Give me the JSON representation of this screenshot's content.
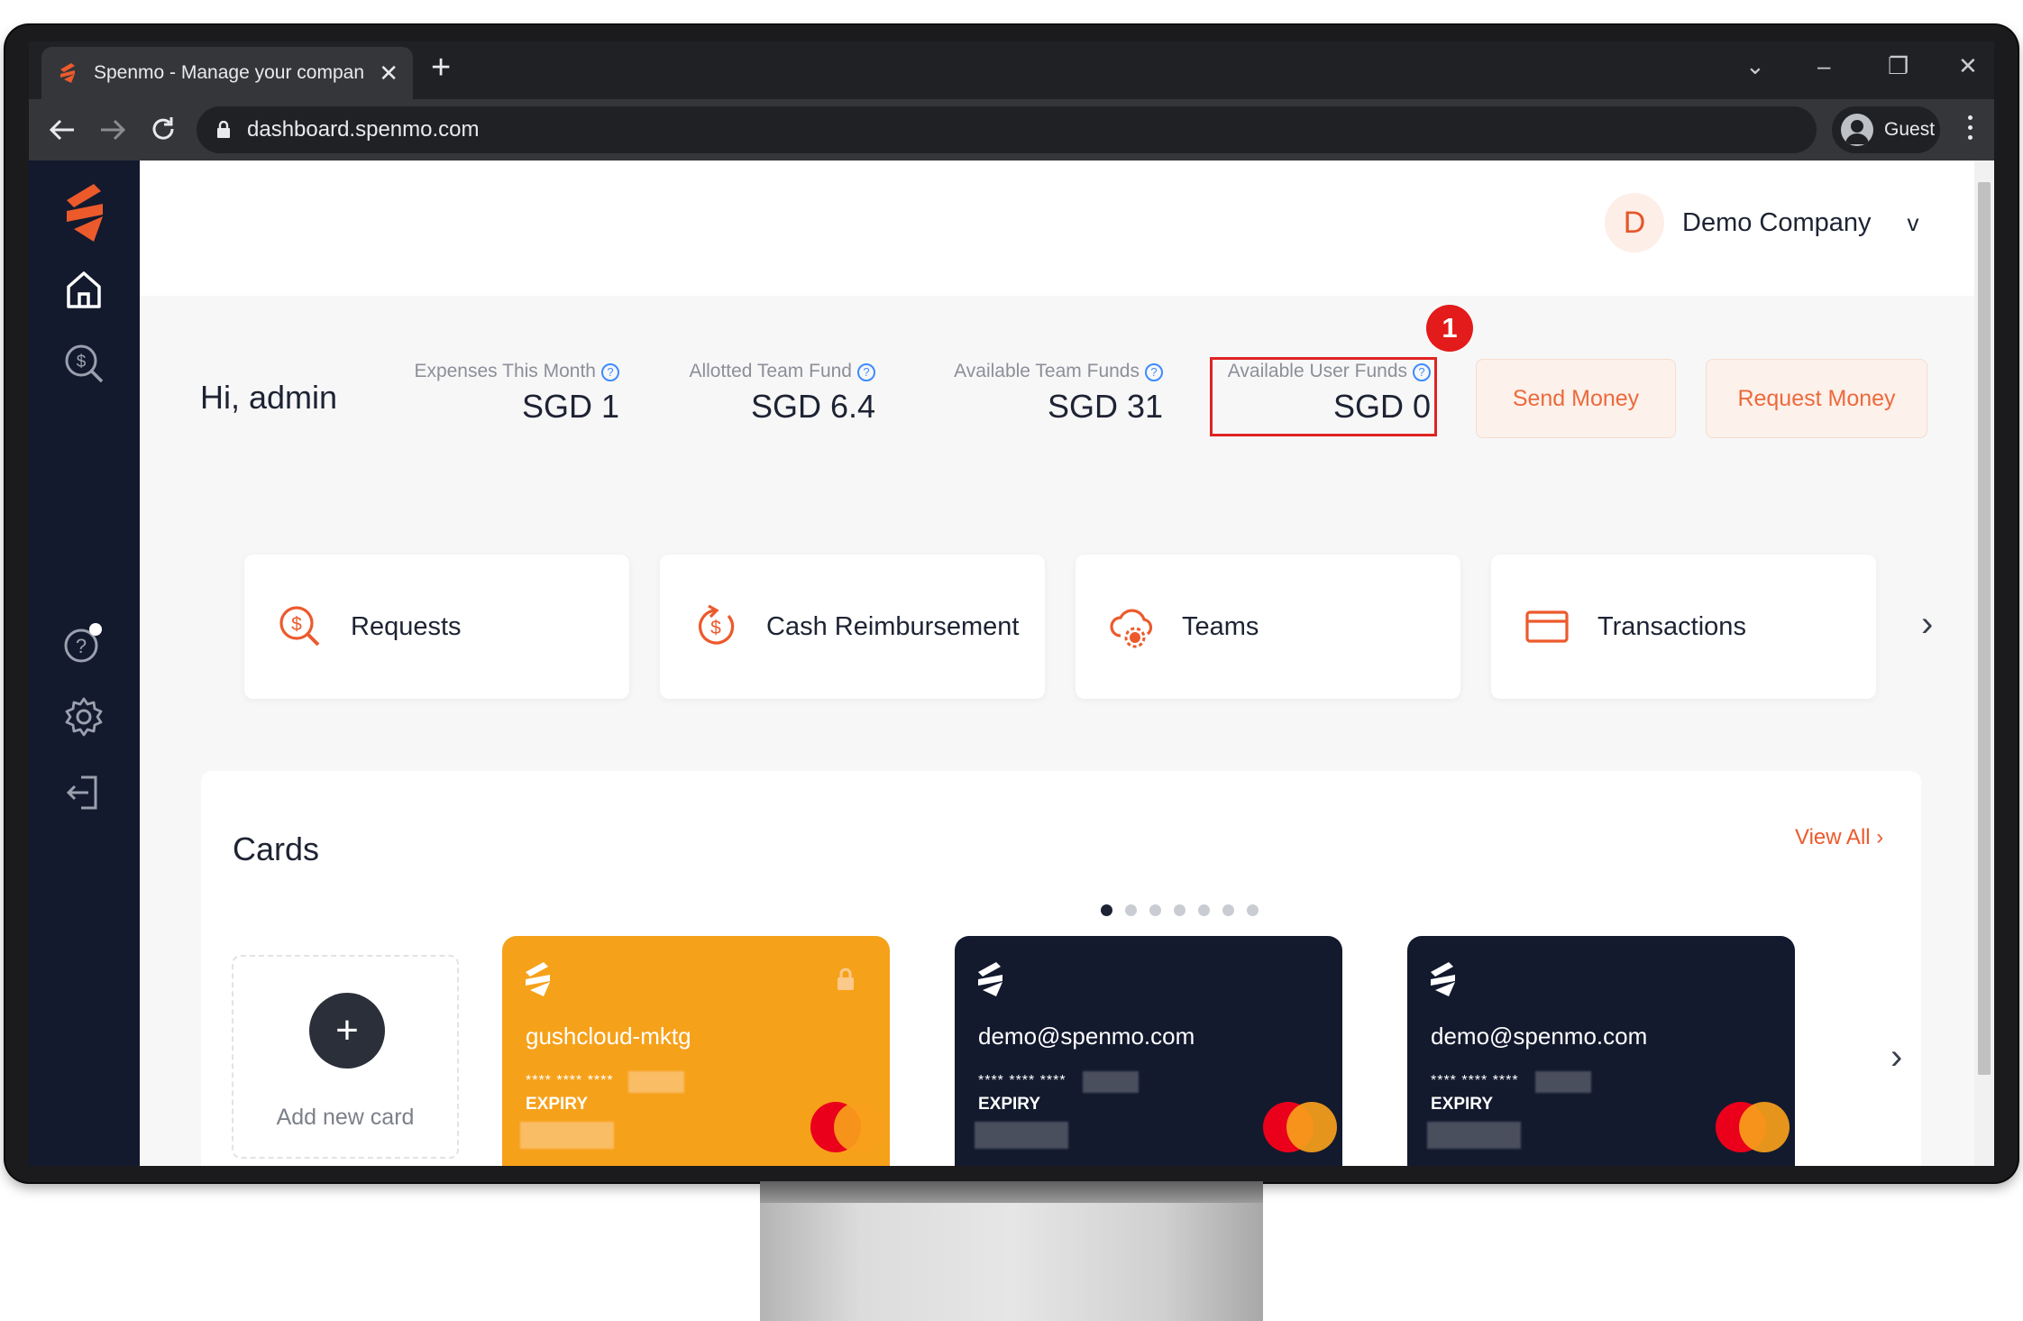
{
  "browser": {
    "tab_title": "Spenmo - Manage your company",
    "tab_close": "✕",
    "new_tab": "+",
    "url": "dashboard.spenmo.com",
    "profile_name": "Guest",
    "window_controls": [
      "⌄",
      "–",
      "❐",
      "✕"
    ]
  },
  "header": {
    "company_initial": "D",
    "company_name": "Demo Company",
    "company_caret": "v"
  },
  "summary": {
    "greeting": "Hi, admin",
    "stats": [
      {
        "label": "Expenses This Month",
        "value": "SGD 1"
      },
      {
        "label": "Allotted Team Fund",
        "value": "SGD 6.4"
      },
      {
        "label": "Available Team Funds",
        "value": "SGD 31"
      },
      {
        "label": "Available User Funds",
        "value": "SGD 0"
      }
    ],
    "help_glyph": "?",
    "annotation_badge": "1",
    "send_money": "Send Money",
    "request_money": "Request Money"
  },
  "shortcuts": {
    "items": [
      {
        "label": "Requests",
        "icon": "dollar-search-icon"
      },
      {
        "label": "Cash Reimbursement",
        "icon": "cash-refresh-icon"
      },
      {
        "label": "Teams",
        "icon": "cloud-gear-icon"
      },
      {
        "label": "Transactions",
        "icon": "credit-card-icon"
      }
    ],
    "next": "›"
  },
  "cards": {
    "title": "Cards",
    "view_all": "View All ›",
    "add_new": "Add new card",
    "add_glyph": "+",
    "carousel_dots": 7,
    "carousel_active": 0,
    "next": "›",
    "items": [
      {
        "name": "gushcloud-mktg",
        "masked": "**** **** ****",
        "expiry_label": "EXPIRY",
        "color": "#f6a11a",
        "locked": true
      },
      {
        "name": "demo@spenmo.com",
        "masked": "**** **** ****",
        "expiry_label": "EXPIRY",
        "color": "#131a2e",
        "locked": false
      },
      {
        "name": "demo@spenmo.com",
        "masked": "**** **** ****",
        "expiry_label": "EXPIRY",
        "color": "#131a2e",
        "locked": false
      }
    ]
  },
  "colors": {
    "brand_orange": "#ec5a2c",
    "sidebar": "#131a2e",
    "highlight_red": "#e02323"
  }
}
